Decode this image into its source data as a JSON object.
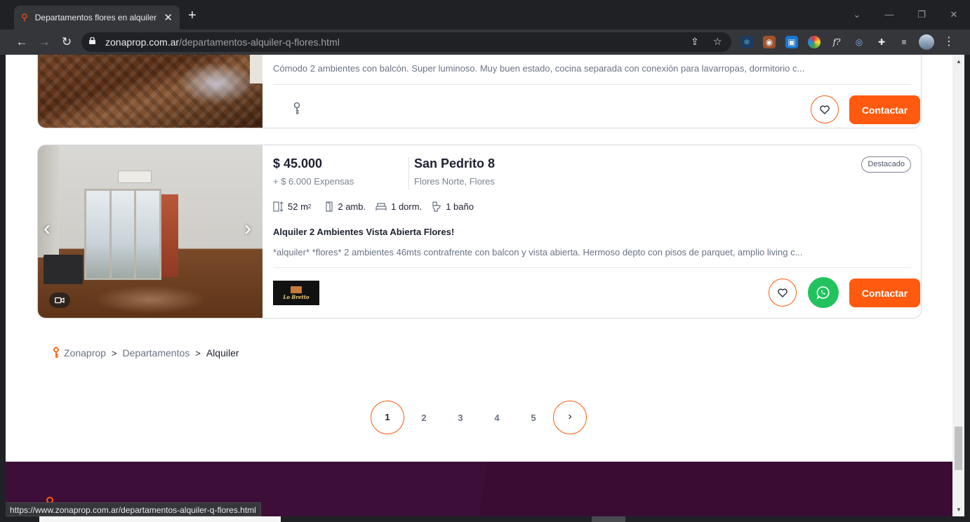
{
  "browser": {
    "tab_title": "Departamentos flores en alquiler",
    "tab_close": "✕",
    "new_tab": "+",
    "url_host": "zonaprop.com.ar",
    "url_path": "/departamentos-alquiler-q-flores.html",
    "status_url": "https://www.zonaprop.com.ar/departamentos-alquiler-q-flores.html",
    "window_controls": {
      "minimize": "—",
      "restore": "❐",
      "close": "✕",
      "chevron": "⌄"
    }
  },
  "listings": [
    {
      "description": "Cómodo 2 ambientes con balcón. Super luminoso.   Muy buen estado, cocina separada con conexión para lavarropas, dormitorio c...",
      "contact_label": "Contactar"
    },
    {
      "price": "$ 45.000",
      "expensas": "+ $ 6.000 Expensas",
      "address": "San Pedrito 8",
      "location": "Flores Norte, Flores",
      "badge": "Destacado",
      "features": {
        "area_value": "52 m",
        "area_unit_sup": "2",
        "rooms": "2 amb.",
        "bedrooms": "1 dorm.",
        "bathrooms": "1 baño"
      },
      "title": "Alquiler 2 Ambientes Vista Abierta Flores!",
      "description": "*alquiler* *flores* 2 ambientes 46mts contrafrente con balcon y vista abierta. Hermoso depto con pisos de parquet, amplio living c...",
      "publisher_logo_text": "Lo Bretto",
      "contact_label": "Contactar"
    }
  ],
  "breadcrumb": {
    "items": [
      "Zonaprop",
      "Departamentos",
      "Alquiler"
    ],
    "separator": ">"
  },
  "pagination": {
    "pages": [
      "1",
      "2",
      "3",
      "4",
      "5"
    ],
    "current": "1",
    "next": "›"
  },
  "colors": {
    "accent": "#ff5a0f",
    "whatsapp": "#22c35e",
    "footer": "#3d0f38"
  }
}
